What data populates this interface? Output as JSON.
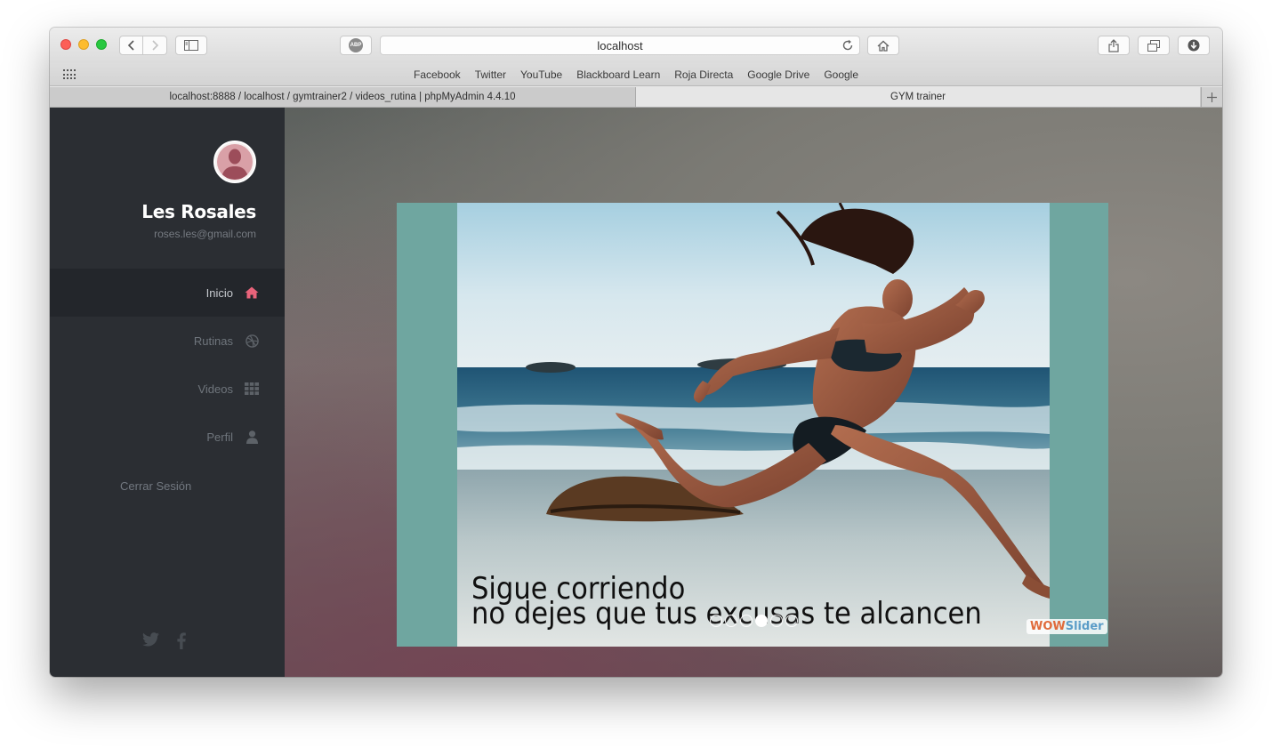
{
  "browser": {
    "url": "localhost",
    "abp_label": "ABP",
    "favorites": [
      "Facebook",
      "Twitter",
      "YouTube",
      "Blackboard Learn",
      "Roja Directa",
      "Google Drive",
      "Google"
    ],
    "tabs": [
      {
        "title": "localhost:8888 / localhost / gymtrainer2 / videos_rutina | phpMyAdmin 4.4.10",
        "active": false
      },
      {
        "title": "GYM trainer",
        "active": true
      }
    ]
  },
  "sidebar": {
    "user_name": "Les Rosales",
    "user_email": "roses.les@gmail.com",
    "items": [
      {
        "label": "Inicio",
        "icon": "home-icon",
        "active": true
      },
      {
        "label": "Rutinas",
        "icon": "dribbble-icon",
        "active": false
      },
      {
        "label": "Videos",
        "icon": "grid-icon",
        "active": false
      },
      {
        "label": "Perfil",
        "icon": "user-icon",
        "active": false
      }
    ],
    "logout_label": "Cerrar Sesión",
    "social": [
      "twitter-icon",
      "facebook-icon"
    ]
  },
  "slider": {
    "caption_line1": "Sigue corriendo",
    "caption_line2": "no dejes que tus excusas te alcancen",
    "bullet_count": 6,
    "active_bullet": 4,
    "badge_part1": "WOW",
    "badge_part2": "Slider"
  },
  "colors": {
    "accent": "#e8637a",
    "sidebar_bg": "#2b2e33",
    "slider_frame": "#6fa6a0"
  }
}
